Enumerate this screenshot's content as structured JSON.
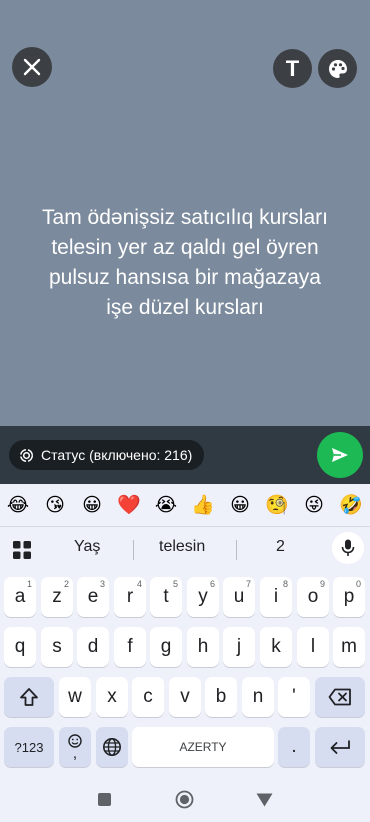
{
  "header": {
    "close_icon": "close-icon",
    "text_tool_label": "T",
    "palette_icon": "palette-icon"
  },
  "status": {
    "text": "Tam ödənişsiz satıcılıq kursları\ntelesin yer az qaldı gel öyren\npulsuz hansısa bir mağazaya\nişe düzel kursları",
    "background_color": "#7b8a9c"
  },
  "privacy": {
    "label": "Статус (включено: 216)"
  },
  "send": {
    "icon": "send-icon",
    "color": "#1db954"
  },
  "keyboard": {
    "emojis": [
      "😂",
      "😘",
      "😀",
      "❤️",
      "😭",
      "👍",
      "😀",
      "🧐",
      "😜",
      "🤣"
    ],
    "suggestions": [
      "Yaş",
      "telesin",
      "2"
    ],
    "row1": [
      {
        "k": "a",
        "h": "1"
      },
      {
        "k": "z",
        "h": "2"
      },
      {
        "k": "e",
        "h": "3"
      },
      {
        "k": "r",
        "h": "4"
      },
      {
        "k": "t",
        "h": "5"
      },
      {
        "k": "y",
        "h": "6"
      },
      {
        "k": "u",
        "h": "7"
      },
      {
        "k": "i",
        "h": "8"
      },
      {
        "k": "o",
        "h": "9"
      },
      {
        "k": "p",
        "h": "0"
      }
    ],
    "row2": [
      "q",
      "s",
      "d",
      "f",
      "g",
      "h",
      "j",
      "k",
      "l",
      "m"
    ],
    "row3": [
      "w",
      "x",
      "c",
      "v",
      "b",
      "n",
      "'"
    ],
    "symbols_label": "?123",
    "emoji_comma": ",",
    "space_label": "AZERTY",
    "period_label": "."
  }
}
